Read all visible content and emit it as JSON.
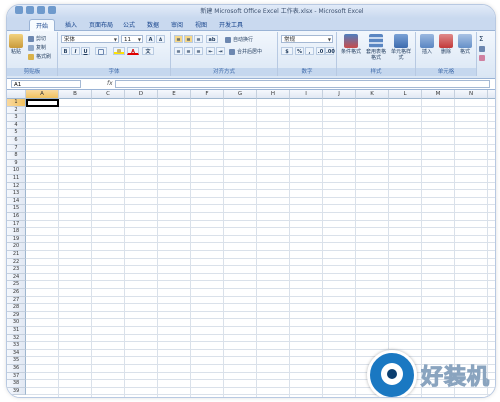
{
  "window": {
    "title": "新建 Microsoft Office Excel 工作表.xlsx - Microsoft Excel"
  },
  "tabs": [
    "开始",
    "插入",
    "页面布局",
    "公式",
    "数据",
    "审阅",
    "视图",
    "开发工具"
  ],
  "ribbon": {
    "clipboard": {
      "label": "剪贴板",
      "paste": "粘贴",
      "cut": "剪切",
      "copy": "复制",
      "format_painter": "格式刷"
    },
    "font": {
      "label": "字体",
      "name": "宋体",
      "size": "11",
      "bold": "B",
      "italic": "I",
      "underline": "U",
      "grow": "A",
      "shrink": "A",
      "color_a": "A"
    },
    "alignment": {
      "label": "对齐方式",
      "wrap": "自动换行",
      "merge": "合并后居中"
    },
    "number": {
      "label": "数字",
      "format": "常规",
      "percent": "%",
      "comma": ","
    },
    "styles": {
      "label": "样式",
      "conditional": "条件格式",
      "table": "套用表格格式",
      "cell_styles": "单元格样式"
    },
    "cells": {
      "label": "单元格",
      "insert": "插入",
      "delete": "删除",
      "format": "格式"
    },
    "editing": {
      "sigma": "Σ"
    }
  },
  "formula_bar": {
    "name_box": "A1",
    "fx": "fx",
    "value": ""
  },
  "columns": [
    "A",
    "B",
    "C",
    "D",
    "E",
    "F",
    "G",
    "H",
    "I",
    "J",
    "K",
    "L",
    "M",
    "N",
    "O"
  ],
  "rows": [
    "1",
    "2",
    "3",
    "4",
    "5",
    "6",
    "7",
    "8",
    "9",
    "10",
    "11",
    "12",
    "13",
    "14",
    "15",
    "16",
    "17",
    "18",
    "19",
    "20",
    "21",
    "22",
    "23",
    "24",
    "25",
    "26",
    "27",
    "28",
    "29",
    "30",
    "31",
    "32",
    "33",
    "34",
    "35",
    "36",
    "37",
    "38",
    "39"
  ],
  "selected_cell": "A1",
  "watermark": {
    "text": "好装机"
  },
  "colors": {
    "ribbon_blue": "#c9d9ef",
    "selection": "#f1c15f",
    "watermark": "#1a78c2"
  }
}
